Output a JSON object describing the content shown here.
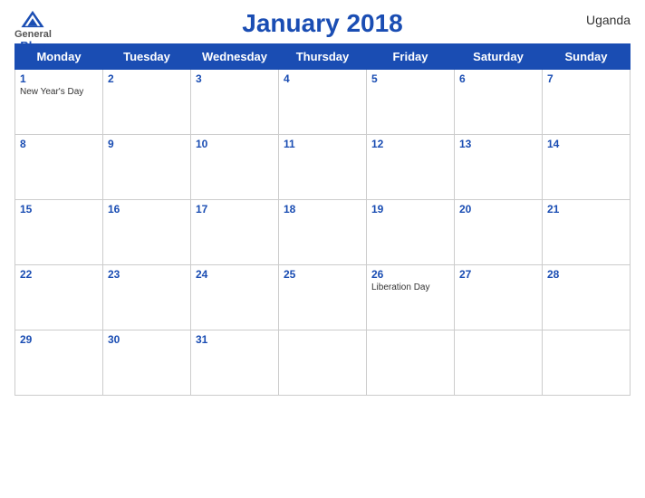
{
  "header": {
    "title": "January 2018",
    "country": "Uganda",
    "logo": {
      "general": "General",
      "blue": "Blue"
    }
  },
  "weekdays": [
    "Monday",
    "Tuesday",
    "Wednesday",
    "Thursday",
    "Friday",
    "Saturday",
    "Sunday"
  ],
  "weeks": [
    [
      {
        "day": 1,
        "holiday": "New Year's Day"
      },
      {
        "day": 2,
        "holiday": ""
      },
      {
        "day": 3,
        "holiday": ""
      },
      {
        "day": 4,
        "holiday": ""
      },
      {
        "day": 5,
        "holiday": ""
      },
      {
        "day": 6,
        "holiday": ""
      },
      {
        "day": 7,
        "holiday": ""
      }
    ],
    [
      {
        "day": 8,
        "holiday": ""
      },
      {
        "day": 9,
        "holiday": ""
      },
      {
        "day": 10,
        "holiday": ""
      },
      {
        "day": 11,
        "holiday": ""
      },
      {
        "day": 12,
        "holiday": ""
      },
      {
        "day": 13,
        "holiday": ""
      },
      {
        "day": 14,
        "holiday": ""
      }
    ],
    [
      {
        "day": 15,
        "holiday": ""
      },
      {
        "day": 16,
        "holiday": ""
      },
      {
        "day": 17,
        "holiday": ""
      },
      {
        "day": 18,
        "holiday": ""
      },
      {
        "day": 19,
        "holiday": ""
      },
      {
        "day": 20,
        "holiday": ""
      },
      {
        "day": 21,
        "holiday": ""
      }
    ],
    [
      {
        "day": 22,
        "holiday": ""
      },
      {
        "day": 23,
        "holiday": ""
      },
      {
        "day": 24,
        "holiday": ""
      },
      {
        "day": 25,
        "holiday": ""
      },
      {
        "day": 26,
        "holiday": "Liberation Day"
      },
      {
        "day": 27,
        "holiday": ""
      },
      {
        "day": 28,
        "holiday": ""
      }
    ],
    [
      {
        "day": 29,
        "holiday": ""
      },
      {
        "day": 30,
        "holiday": ""
      },
      {
        "day": 31,
        "holiday": ""
      },
      {
        "day": null,
        "holiday": ""
      },
      {
        "day": null,
        "holiday": ""
      },
      {
        "day": null,
        "holiday": ""
      },
      {
        "day": null,
        "holiday": ""
      }
    ]
  ],
  "colors": {
    "header_bg": "#1a4db3",
    "header_text": "#ffffff",
    "day_number": "#1a4db3"
  }
}
